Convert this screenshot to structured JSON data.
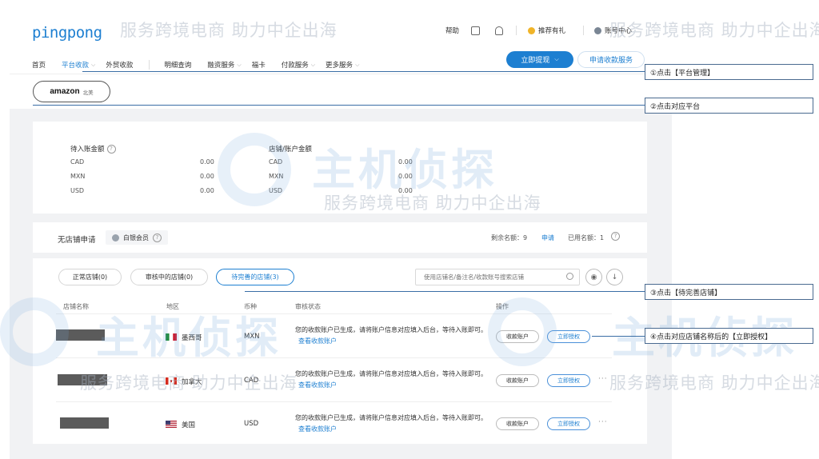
{
  "header": {
    "logo": "pingpong",
    "help": "帮助",
    "referral": "推荐有礼",
    "account_center": "账号中心"
  },
  "nav": {
    "items": [
      "首页",
      "平台收款",
      "外贸收款",
      "明细查询",
      "融资服务",
      "福卡",
      "付款服务",
      "更多服务"
    ],
    "withdraw_button": "立即提现",
    "apply_button": "申请收款服务"
  },
  "platform": {
    "name": "amazon",
    "region": "北美"
  },
  "balances": {
    "pending_title": "待入账金额",
    "store_title": "店铺/账户金额",
    "rows": [
      {
        "currency": "CAD",
        "pending": "0.00",
        "store": "0.00"
      },
      {
        "currency": "MXN",
        "pending": "0.00",
        "store": "0.00"
      },
      {
        "currency": "USD",
        "pending": "0.00",
        "store": "0.00"
      }
    ]
  },
  "store_app": {
    "title": "无店铺申请",
    "member": "白银会员",
    "remaining": "剩余名额：9",
    "apply_link": "申请",
    "used": "已用名额：1"
  },
  "tabs": [
    "正常店铺(0)",
    "审核中的店铺(0)",
    "待完善的店铺(3)"
  ],
  "search": {
    "placeholder": "使用店铺名/备注名/收款账号搜索店铺"
  },
  "table": {
    "headers": [
      "店铺名称",
      "地区",
      "币种",
      "审核状态",
      "操作"
    ],
    "status_text": "您的收款账户已生成，请将账户信息对应填入后台，等待入账即可。",
    "status_link": "查看收款账户",
    "btn_account": "收款账户",
    "btn_authorize": "立即授权",
    "rows": [
      {
        "region": "墨西哥",
        "currency": "MXN"
      },
      {
        "region": "加拿大",
        "currency": "CAD"
      },
      {
        "region": "美国",
        "currency": "USD"
      }
    ]
  },
  "annotations": [
    "①点击【平台管理】",
    "②点击对应平台",
    "③点击【待完善店铺】",
    "④点击对应店铺名称后的【立即授权】"
  ],
  "watermark": {
    "slogan": "服务跨境电商  助力中企出海",
    "brand": "主机侦探"
  },
  "colors": {
    "accent": "#1d7fd1",
    "annotation_line": "#3a6ea5"
  }
}
